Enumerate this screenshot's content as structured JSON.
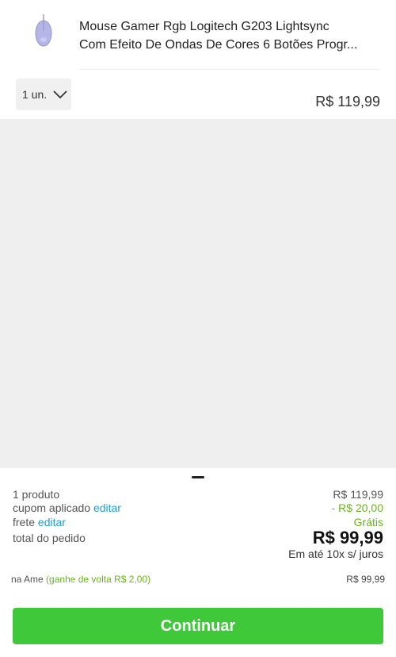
{
  "product": {
    "title_line1": "Mouse Gamer Rgb Logitech G203 Lightsync",
    "title_line2": "Com Efeito De Ondas De Cores 6 Botões Progr...",
    "quantity": "1 un.",
    "price": "R$ 119,99"
  },
  "summary": {
    "products_label": "1 produto",
    "products_value": "R$ 119,99",
    "coupon_label": "cupom aplicado",
    "coupon_edit": "editar",
    "coupon_value": "- R$ 20,00",
    "shipping_label": "frete",
    "shipping_edit": "editar",
    "shipping_value": "Grátis",
    "total_label": "total do pedido",
    "total_value": "R$ 99,99",
    "installments": "Em até 10x s/ juros",
    "ame_label": "na Ame",
    "ame_cashback": "(ganhe de volta R$ 2,00)",
    "ame_price": "R$ 99,99"
  },
  "actions": {
    "continue_label": "Continuar"
  },
  "colors": {
    "accent_green": "#3ec83a",
    "discount_green": "#6ab320",
    "link_blue": "#1a9fd8"
  }
}
